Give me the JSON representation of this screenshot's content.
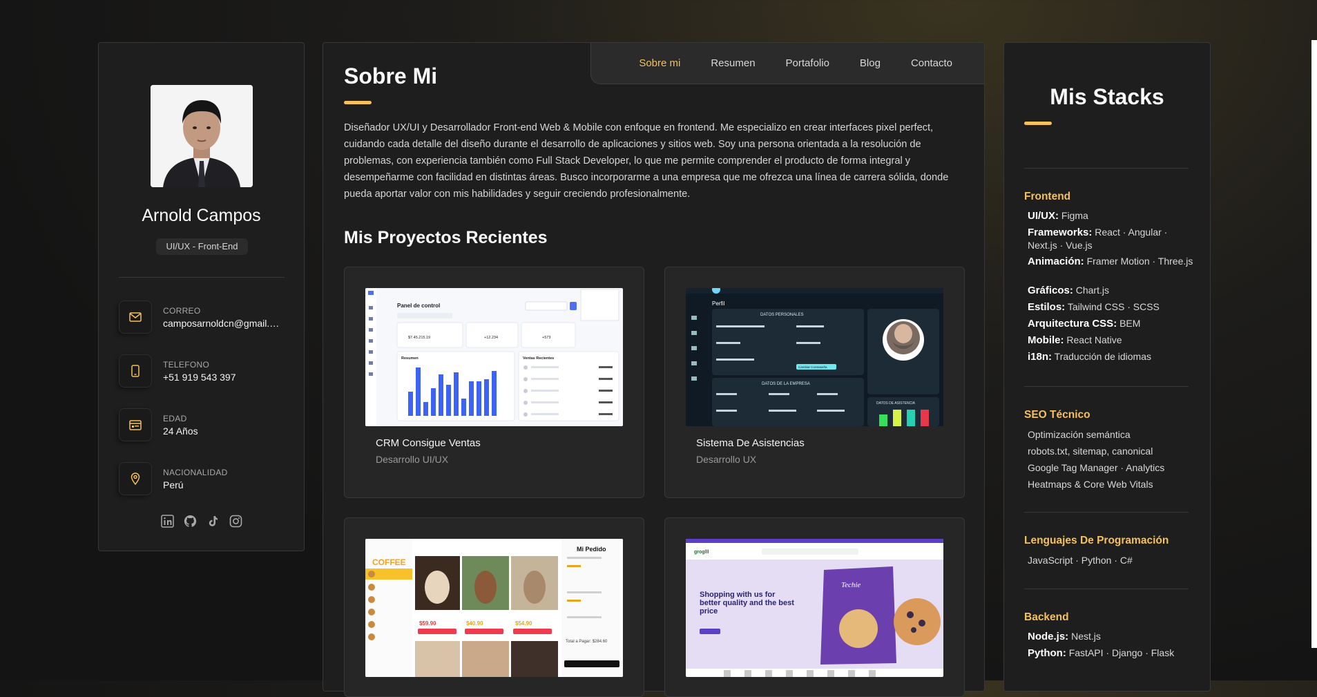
{
  "profile": {
    "name": "Arnold Campos",
    "role": "UI/UX - Front-End",
    "contacts": [
      {
        "icon": "mail-icon",
        "label": "CORREO",
        "value": "camposarnoldcn@gmail.com"
      },
      {
        "icon": "phone-icon",
        "label": "TELEFONO",
        "value": "+51 919 543 397"
      },
      {
        "icon": "calendar-icon",
        "label": "EDAD",
        "value": "24 Años"
      },
      {
        "icon": "location-pin-icon",
        "label": "NACIONALIDAD",
        "value": "Perú"
      }
    ],
    "socials": [
      "linkedin-icon",
      "github-icon",
      "tiktok-icon",
      "instagram-icon"
    ]
  },
  "nav": {
    "items": [
      "Sobre mi",
      "Resumen",
      "Portafolio",
      "Blog",
      "Contacto"
    ],
    "active": "Sobre mi"
  },
  "about": {
    "title": "Sobre Mi",
    "text": "Diseñador UX/UI y Desarrollador Front-end Web & Mobile con enfoque en frontend. Me especializo en crear interfaces pixel perfect, cuidando cada detalle del diseño durante el desarrollo de aplicaciones y sitios web. Soy una persona orientada a la resolución de problemas, con experiencia también como Full Stack Developer, lo que me permite comprender el producto de forma integral y desempeñarme con facilidad en distintas áreas. Busco incorporarme a una empresa que me ofrezca una línea de carrera sólida, donde pueda aportar valor con mis habilidades y seguir creciendo profesionalmente."
  },
  "projects": {
    "title": "Mis Proyectos Recientes",
    "items": [
      {
        "title": "CRM Consigue Ventas",
        "subtitle": "Desarrollo UI/UX",
        "thumb_heading": "Panel de control",
        "thumb_metrics": [
          "$7.45.215.19",
          "+12.234",
          "+573"
        ],
        "thumb_chart_label": "Resumen",
        "thumb_list_label": "Ventas Recientes"
      },
      {
        "title": "Sistema De Asistencias",
        "subtitle": "Desarrollo UX",
        "thumb_heading": "Perfil",
        "thumb_section_1": "DATOS PERSONALES",
        "thumb_section_2": "DATOS DE LA EMPRESA",
        "thumb_section_3": "DATOS DE ASISTENCIA",
        "thumb_button": "Cambiar Contraseña"
      },
      {
        "title": "",
        "subtitle": "",
        "thumb_heading": "Mi Pedido",
        "thumb_brand": "COFFEE",
        "thumb_prices": [
          "$59.90",
          "$40.90",
          "$54.90"
        ],
        "thumb_total": "Total a Pagar: $284.60"
      },
      {
        "title": "",
        "subtitle": "",
        "thumb_brand": "groglll",
        "thumb_headline": "Shopping with us for better quality and the best price",
        "thumb_product": "Techie"
      }
    ]
  },
  "stacks": {
    "title": "Mis Stacks",
    "sections": [
      {
        "heading": "Frontend",
        "lines": [
          {
            "k": "UI/UX:",
            "v": "Figma"
          },
          {
            "k": "Frameworks:",
            "v": "React · Angular · Next.js · Vue.js"
          },
          {
            "k": "Animación:",
            "v": "Framer Motion · Three.js"
          },
          {
            "k": "Gráficos:",
            "v": "Chart.js"
          },
          {
            "k": "Estilos:",
            "v": "Tailwind CSS · SCSS"
          },
          {
            "k": "Arquitectura CSS:",
            "v": "BEM"
          },
          {
            "k": "Mobile:",
            "v": "React Native"
          },
          {
            "k": "i18n:",
            "v": "Traducción de idiomas"
          }
        ]
      },
      {
        "heading": "SEO Técnico",
        "lines": [
          {
            "k": "",
            "v": "Optimización semántica"
          },
          {
            "k": "",
            "v": "robots.txt, sitemap, canonical"
          },
          {
            "k": "",
            "v": "Google Tag Manager · Analytics"
          },
          {
            "k": "",
            "v": "Heatmaps & Core Web Vitals"
          }
        ]
      },
      {
        "heading": "Lenguajes De Programación",
        "lines": [
          {
            "k": "",
            "v": "JavaScript · Python · C#"
          }
        ]
      },
      {
        "heading": "Backend",
        "lines": [
          {
            "k": "Node.js:",
            "v": "Nest.js"
          },
          {
            "k": "Python:",
            "v": "FastAPI · Django · Flask"
          }
        ]
      }
    ]
  },
  "colors": {
    "accent": "#f5c15a",
    "card": "#1e1e1f",
    "border": "#383838"
  }
}
